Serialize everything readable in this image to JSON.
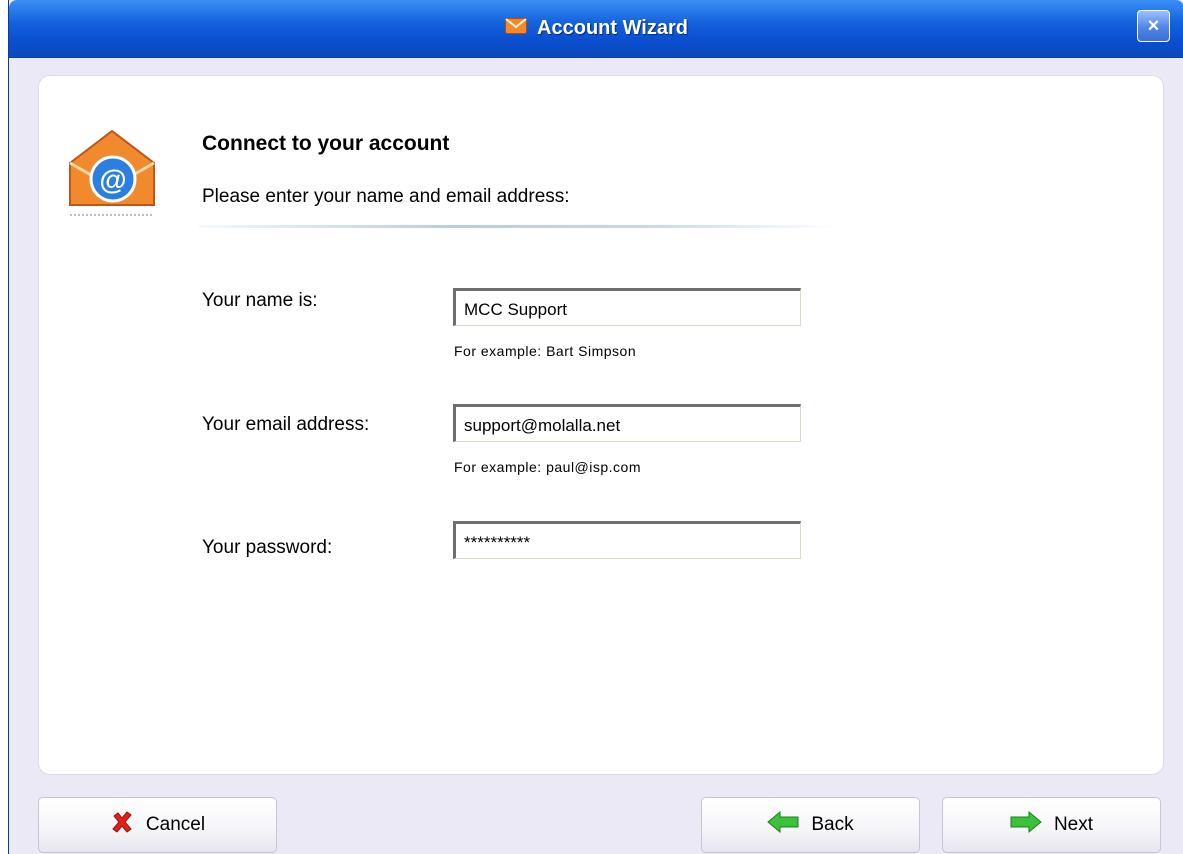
{
  "window": {
    "title": "Account Wizard",
    "close_label": "×"
  },
  "header": {
    "heading": "Connect to your account",
    "subheading": "Please enter your name and email address:"
  },
  "form": {
    "name": {
      "label": "Your name is:",
      "value": "MCC Support",
      "hint": "For example: Bart Simpson"
    },
    "email": {
      "label": "Your email address:",
      "value": "support@molalla.net",
      "hint": "For example: paul@isp.com"
    },
    "password": {
      "label": "Your password:",
      "value": "**********"
    }
  },
  "buttons": {
    "cancel": "Cancel",
    "back": "Back",
    "next": "Next"
  },
  "icons": {
    "title": "envelope-icon",
    "app": "email-at-icon",
    "cancel": "red-x-icon",
    "back": "green-left-arrow-icon",
    "next": "green-right-arrow-icon"
  },
  "colors": {
    "titlebar": "#0a4fd0",
    "panel": "#ffffff",
    "frame": "#ece9f6"
  }
}
